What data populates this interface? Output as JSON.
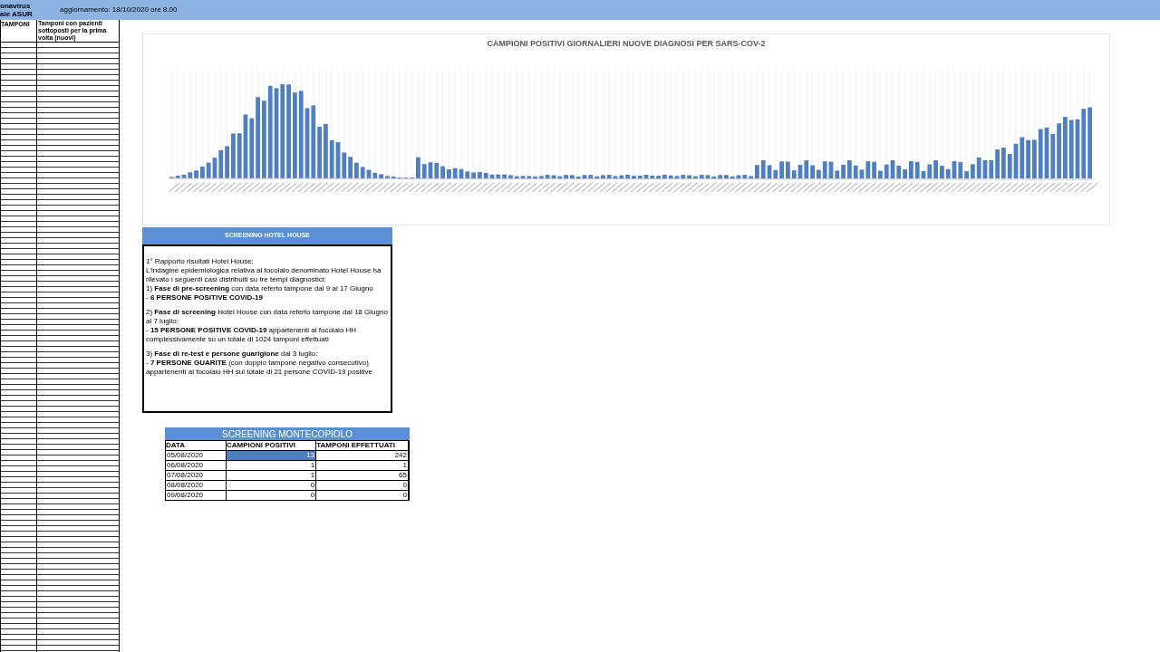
{
  "header": {
    "title_lines": [
      "onavirus",
      "ale ASUR"
    ],
    "updated": "aggiornamento: 18/10/2020 ore 8.00"
  },
  "left_table": {
    "columns": [
      "TAMPONI",
      "Tamponi con pazienti sottoposti per la prima volta (nuovi)"
    ]
  },
  "chart": {
    "title": "CAMPIONI POSITIVI GIORNALIERI NUOVE DIAGNOSI PER SARS-COV-2"
  },
  "hotel_house": {
    "title": "SCREENING HOTEL HOUSE",
    "paragraphs": [
      "1° Rapporto risultati Hotel House:\nL'indagine epidemiologica relativa al focolaio denominato Hotel House ha rilevato i seguenti casi distribuiti su tre tempi diagnostici:\n1) **Fase di pre-screening** con data referto tampone dal 9 al 17 Giugno\n- **6 PERSONE POSITIVE COVID-19**",
      "2) **Fase di screening** Hotel House con data referto tampone dal 18 Giugno al 7 luglio:\n- **15 PERSONE POSITIVE COVID-19** appartenenti al focolaio HH complessivamente su un totale di 1024 tamponi effettuati",
      "3) **Fase di re-test e persone guarigione** dal 3 luglio:\n- **7 PERSONE GUARITE** (con doppio tampone negativo consecutivo) appartenenti al focolaio HH sul totale di 21 persone COVID-19 positive"
    ]
  },
  "montecopiolo": {
    "title": "SCREENING MONTECOPIOLO",
    "columns": [
      "DATA",
      "CAMPIONI POSITIVI",
      "TAMPONI EFFETTUATI"
    ],
    "rows": [
      {
        "cells": [
          "05/08/2020",
          "13",
          "242"
        ],
        "selected": true
      },
      {
        "cells": [
          "06/08/2020",
          "1",
          "1"
        ],
        "selected": false
      },
      {
        "cells": [
          "07/08/2020",
          "1",
          "65"
        ],
        "selected": false
      },
      {
        "cells": [
          "08/08/2020",
          "0",
          "0"
        ],
        "selected": false
      },
      {
        "cells": [
          "09/08/2020",
          "0",
          "0"
        ],
        "selected": false
      }
    ]
  }
}
